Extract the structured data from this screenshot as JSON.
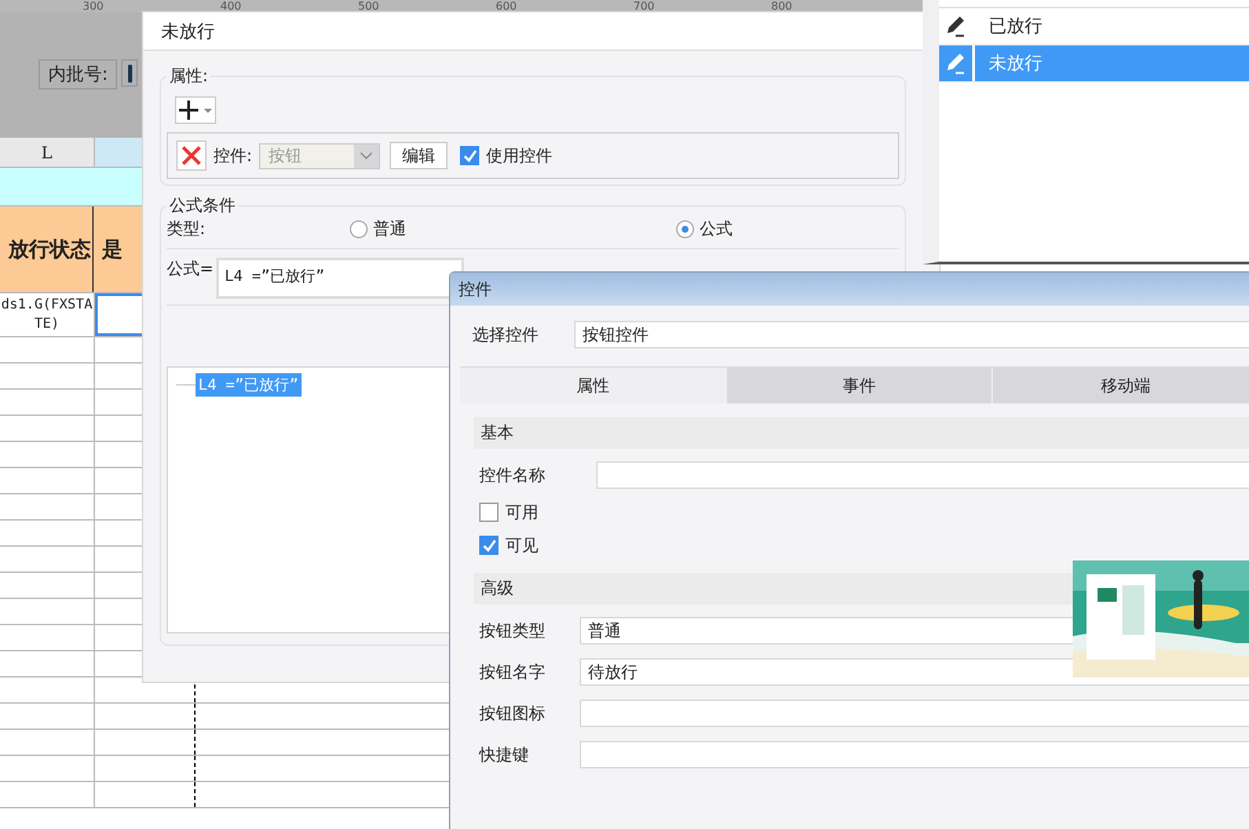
{
  "ruler": {
    "labels": [
      "300",
      "400",
      "500",
      "600",
      "700",
      "800"
    ]
  },
  "sheet": {
    "batch_label": "内批号:",
    "columns": [
      {
        "label": "L",
        "selected": false
      },
      {
        "selected": true
      }
    ],
    "header_cells": [
      "放行状态",
      "是"
    ],
    "formula_cell": "ds1.G(FXSTATE)"
  },
  "conditions_list": {
    "items": [
      {
        "label": "已放行",
        "selected": false
      },
      {
        "label": "未放行",
        "selected": true
      }
    ]
  },
  "condition_dialog": {
    "title": "未放行",
    "attributes": {
      "legend": "属性:",
      "control_label": "控件:",
      "control_value": "按钮",
      "control_disabled": true,
      "edit_button": "编辑",
      "use_control": {
        "label": "使用控件",
        "checked": true
      }
    },
    "formula_condition": {
      "legend": "公式条件",
      "type_label": "类型:",
      "types": [
        {
          "label": "普通",
          "selected": false
        },
        {
          "label": "公式",
          "selected": true
        }
      ],
      "formula_label": "公式=",
      "formula": "L4 =”已放行”",
      "tree_items": [
        {
          "label": "L4 =”已放行”",
          "selected": true
        }
      ]
    }
  },
  "control_dialog": {
    "title": "控件",
    "select_label": "选择控件",
    "select_value": "按钮控件",
    "tabs": [
      {
        "label": "属性",
        "selected": true
      },
      {
        "label": "事件",
        "selected": false
      },
      {
        "label": "移动端",
        "selected": false
      }
    ],
    "sections": [
      {
        "title": "基本",
        "rows": [
          {
            "kind": "field",
            "label": "控件名称"
          },
          {
            "kind": "checkbox",
            "label": "可用",
            "checked": false
          },
          {
            "kind": "checkbox",
            "label": "可见",
            "checked": true
          }
        ]
      },
      {
        "title": "高级",
        "rows": [
          {
            "kind": "field",
            "label": "按钮类型",
            "value": "普通"
          },
          {
            "kind": "field",
            "label": "按钮名字",
            "value": "待放行"
          },
          {
            "kind": "field",
            "label": "按钮图标"
          },
          {
            "kind": "field",
            "label": "快捷键"
          }
        ]
      }
    ]
  }
}
